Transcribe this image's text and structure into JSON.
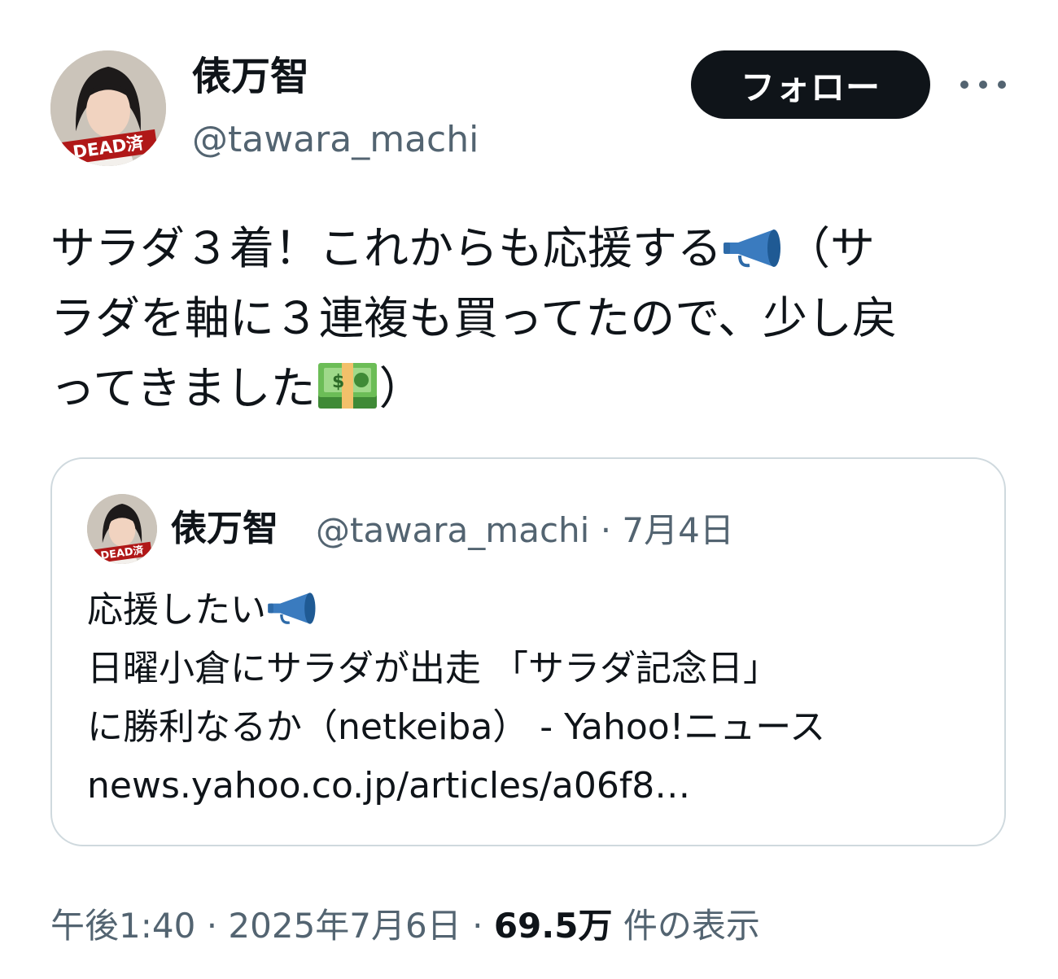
{
  "author": {
    "display_name": "俵万智",
    "handle": "@tawara_machi",
    "avatar_badge": "DEAD済"
  },
  "actions": {
    "follow_label": "フォロー",
    "more_icon": "more-horizontal-icon"
  },
  "tweet": {
    "text_lines": [
      "サラダ３着！これからも応援する",
      "（サ",
      "ラダを軸に３連複も買ってたので、少し戻",
      "ってきました",
      "）"
    ],
    "emojis": [
      "megaphone-icon",
      "money-bills-icon"
    ]
  },
  "quoted": {
    "display_name": "俵万智",
    "handle": "@tawara_machi",
    "separator": "·",
    "date": "7月4日",
    "text_lines": [
      "応援したい",
      "日曜小倉にサラダが出走 「サラダ記念日」",
      "に勝利なるか（netkeiba） - Yahoo!ニュース",
      "news.yahoo.co.jp/articles/a06f8…"
    ]
  },
  "footer": {
    "time": "午後1:40",
    "separator": "·",
    "date": "2025年7月6日",
    "views_count": "69.5万",
    "views_label": "件の表示"
  },
  "colors": {
    "text_primary": "#0f1419",
    "text_secondary": "#536471",
    "border": "#cfd9de",
    "follow_bg": "#0f1419",
    "megaphone": "#3a7bbf",
    "money_green": "#5aa84a"
  }
}
